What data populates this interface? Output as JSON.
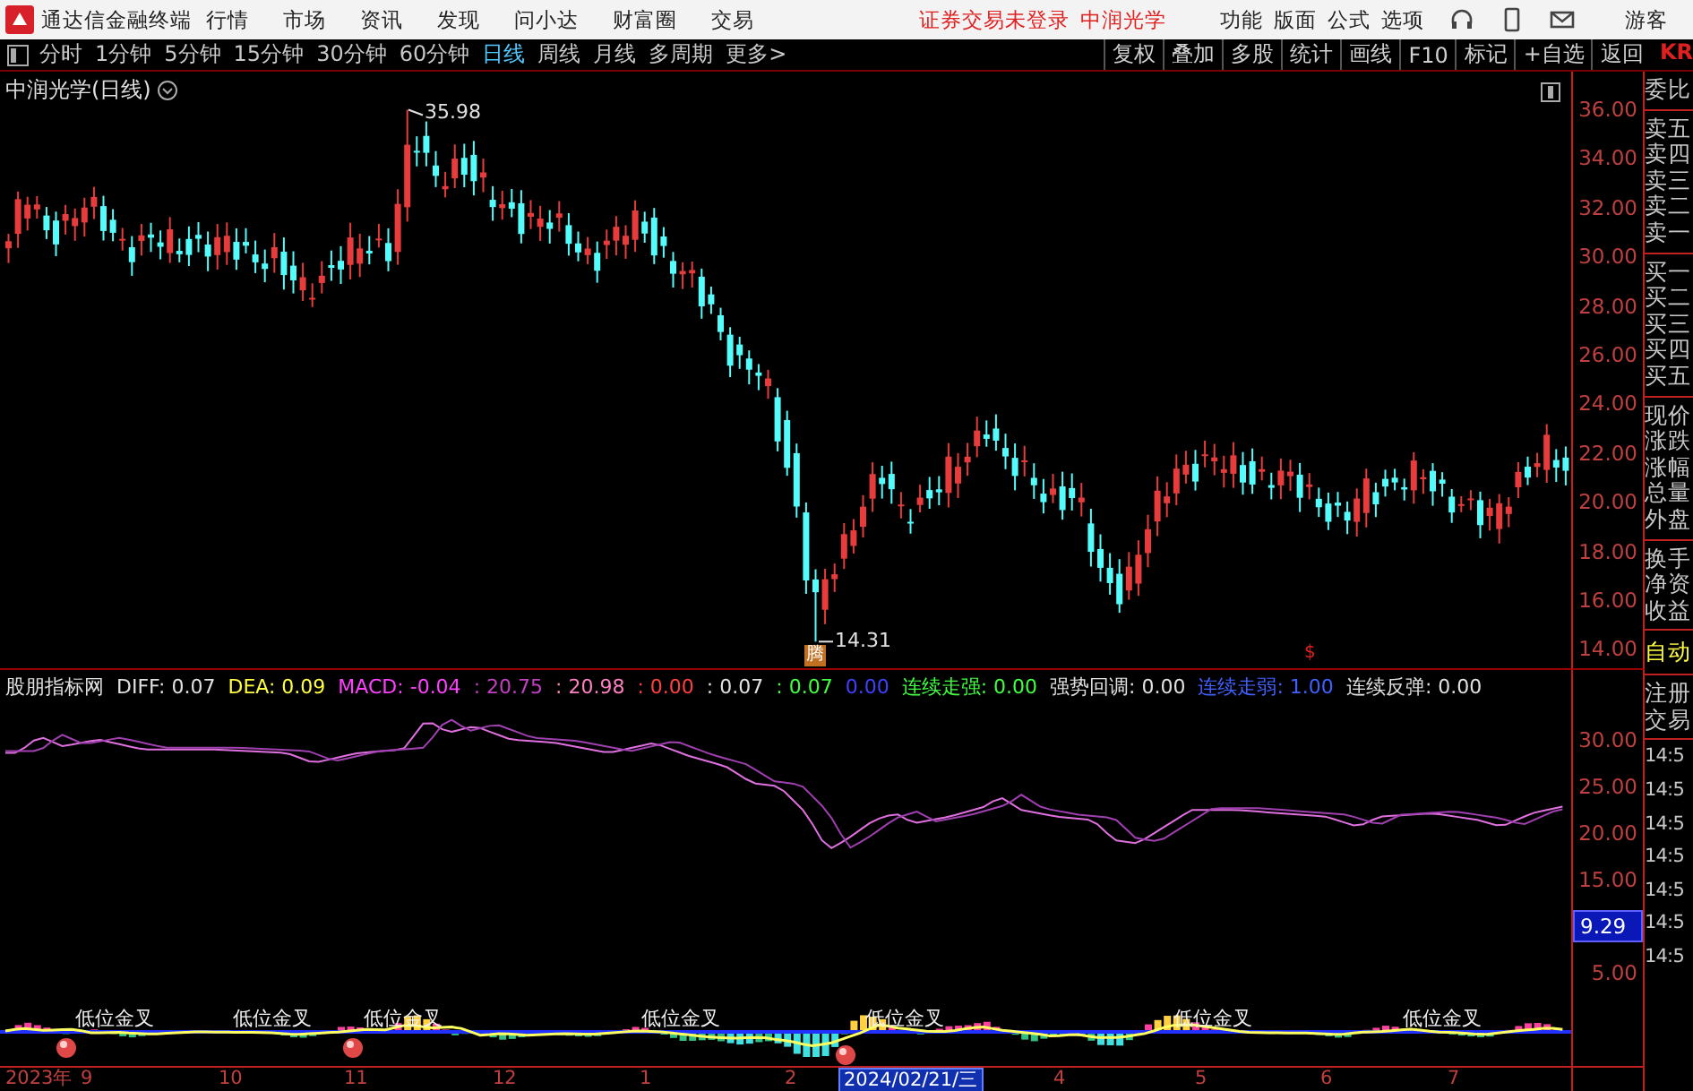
{
  "title_bar": {
    "app_name": "通达信金融终端",
    "menu": [
      "行情",
      "市场",
      "资讯",
      "发现",
      "问小达",
      "财富圈",
      "交易"
    ],
    "status": "证券交易未登录",
    "stock": "中润光学",
    "tools": [
      "功能",
      "版面",
      "公式",
      "选项"
    ],
    "user": "游客"
  },
  "period_bar": {
    "periods": [
      {
        "label": "分时",
        "selected": false
      },
      {
        "label": "1分钟",
        "selected": false
      },
      {
        "label": "5分钟",
        "selected": false
      },
      {
        "label": "15分钟",
        "selected": false
      },
      {
        "label": "30分钟",
        "selected": false
      },
      {
        "label": "60分钟",
        "selected": false
      },
      {
        "label": "日线",
        "selected": true
      },
      {
        "label": "周线",
        "selected": false
      },
      {
        "label": "月线",
        "selected": false
      },
      {
        "label": "多周期",
        "selected": false
      },
      {
        "label": "更多>",
        "selected": false
      }
    ],
    "tools": [
      "复权",
      "叠加",
      "多股",
      "统计",
      "画线",
      "F10",
      "标记",
      "+自选",
      "返回"
    ],
    "cut_label": "KR"
  },
  "price_chart": {
    "title": "中润光学(日线)",
    "yticks": [
      "36.00",
      "34.00",
      "32.00",
      "30.00",
      "28.00",
      "26.00",
      "24.00",
      "22.00",
      "20.00",
      "18.00",
      "16.00",
      "14.00"
    ],
    "high_label": "35.98",
    "low_label": "14.31",
    "badge": "腾",
    "marker": "$"
  },
  "indicator": {
    "name": "股朋指标网",
    "readings": [
      {
        "text": "DIFF: 0.07",
        "color": "#e0e0e0"
      },
      {
        "text": "DEA: 0.09",
        "color": "#ffff40"
      },
      {
        "text": "MACD: -0.04",
        "color": "#ff40ff"
      },
      {
        "text": ": 20.75",
        "color": "#c040c0"
      },
      {
        "text": ": 20.98",
        "color": "#ff80c0"
      },
      {
        "text": ": 0.00",
        "color": "#ff4040"
      },
      {
        "text": ": 0.07",
        "color": "#e0e0e0"
      },
      {
        "text": ": 0.07",
        "color": "#40ff40"
      },
      {
        "text": "0.00",
        "color": "#4040ff"
      },
      {
        "text": "连续走强: 0.00",
        "color": "#40ff40"
      },
      {
        "text": "强势回调: 0.00",
        "color": "#e0e0e0"
      },
      {
        "text": "连续走弱: 1.00",
        "color": "#4060ff"
      },
      {
        "text": "连续反弹: 0.00",
        "color": "#e0e0e0"
      }
    ],
    "yticks": [
      {
        "text": "30.00",
        "kind": "tick"
      },
      {
        "text": "25.00",
        "kind": "tick"
      },
      {
        "text": "20.00",
        "kind": "tick"
      },
      {
        "text": "15.00",
        "kind": "tick"
      },
      {
        "text": "9.29",
        "kind": "cursor"
      },
      {
        "text": "5.00",
        "kind": "tick"
      }
    ]
  },
  "signals": {
    "labels": [
      "低位金叉",
      "低位金叉",
      "低位金叉",
      "低位金叉",
      "低位金叉",
      "低位金叉",
      "低位金叉"
    ]
  },
  "date_axis": {
    "labels": [
      {
        "text": "2023年",
        "selected": false
      },
      {
        "text": "9",
        "selected": false
      },
      {
        "text": "10",
        "selected": false
      },
      {
        "text": "11",
        "selected": false
      },
      {
        "text": "12",
        "selected": false
      },
      {
        "text": "1",
        "selected": false
      },
      {
        "text": "2",
        "selected": false
      },
      {
        "text": "2024/02/21/三",
        "selected": true
      },
      {
        "text": "4",
        "selected": false
      },
      {
        "text": "5",
        "selected": false
      },
      {
        "text": "6",
        "selected": false
      },
      {
        "text": "7",
        "selected": false
      }
    ]
  },
  "quote_panel": {
    "groups": [
      [
        "委比"
      ],
      [
        "卖五",
        "卖四",
        "卖三",
        "卖二",
        "卖一"
      ],
      [
        "买一",
        "买二",
        "买三",
        "买四",
        "买五"
      ],
      [
        "现价",
        "涨跌",
        "涨幅",
        "总量",
        "外盘"
      ],
      [
        "换手",
        "净资",
        "收益"
      ]
    ],
    "mode": "自动",
    "links": [
      "注册",
      "交易"
    ],
    "times": [
      "14:5",
      "14:5",
      "14:5",
      "14:5",
      "14:5",
      "14:5",
      "14:5"
    ]
  }
}
